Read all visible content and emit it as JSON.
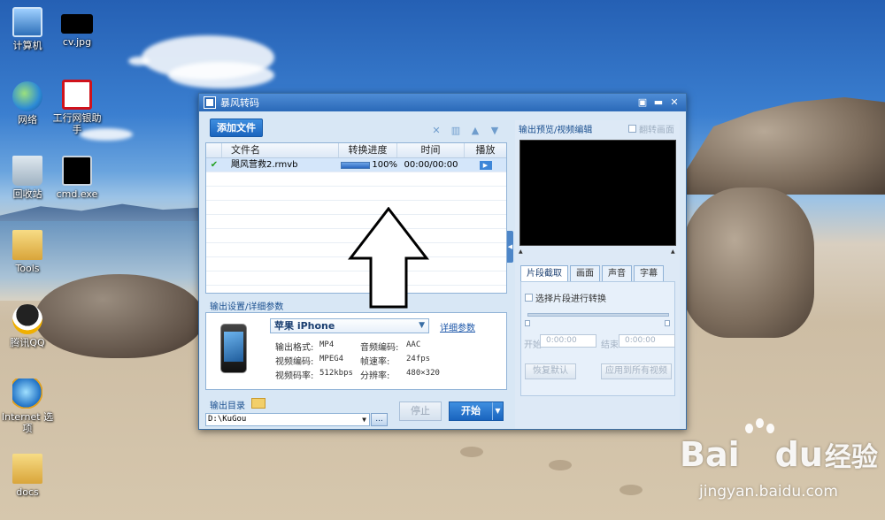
{
  "desktop": {
    "icons": [
      {
        "label": "计算机"
      },
      {
        "label": "cv.jpg"
      },
      {
        "label": "网络"
      },
      {
        "label": "工行网银助手"
      },
      {
        "label": "回收站"
      },
      {
        "label": "cmd.exe"
      },
      {
        "label": "Tools"
      },
      {
        "label": "腾讯QQ"
      },
      {
        "label": "Internet 选项"
      },
      {
        "label": "docs"
      }
    ]
  },
  "watermark": {
    "brand": "Bai",
    "brand2": "du",
    "cn": "经验",
    "url": "jingyan.baidu.com"
  },
  "window": {
    "title": "暴风转码",
    "add_file": "添加文件",
    "toolbar_icons": [
      "close-icon",
      "trash-icon",
      "arrow-up-icon",
      "arrow-down-icon"
    ],
    "list": {
      "columns": [
        "文件名",
        "转换进度",
        "时间",
        "播放"
      ],
      "rows": [
        {
          "name": "飓风营救2.rmvb",
          "progress_text": "100%",
          "progress": 1.0,
          "time": "00:00/00:00"
        }
      ]
    },
    "output_settings_label": "输出设置/详细参数",
    "device": "苹果 iPhone",
    "detail_link": "详细参数",
    "params": {
      "format_label": "输出格式:",
      "format": "MP4",
      "audio_label": "音频编码:",
      "audio": "AAC",
      "video_label": "视频编码:",
      "video": "MPEG4",
      "fps_label": "帧速率:",
      "fps": "24fps",
      "bitrate_label": "视频码率:",
      "bitrate": "512kbps",
      "res_label": "分辨率:",
      "res": "480×320"
    },
    "output_dir_label": "输出目录",
    "output_path": "D:\\KuGou",
    "browse": "...",
    "stop": "停止",
    "start": "开始",
    "preview_label": "输出预览/视频编辑",
    "flip_label": "翻转画面",
    "tabs": [
      "片段截取",
      "画面",
      "声音",
      "字幕"
    ],
    "clip_check_label": "选择片段进行转换",
    "start_label": "开始",
    "start_time": "0:00:00",
    "end_label": "结束",
    "end_time": "0:00:00",
    "reset": "恢复默认",
    "apply_all": "应用到所有视频"
  }
}
